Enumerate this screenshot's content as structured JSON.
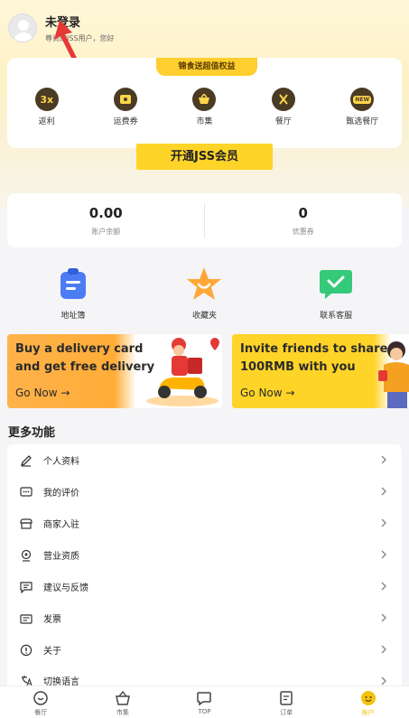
{
  "profile": {
    "name": "未登录",
    "subtitle": "尊贵的JSS用户，您好"
  },
  "benefits": {
    "tag": "锦食送超值权益",
    "items": [
      {
        "label": "返利",
        "icon": "rebate-icon",
        "glyph": "3x"
      },
      {
        "label": "运费券",
        "icon": "coupon-icon",
        "glyph": ""
      },
      {
        "label": "市集",
        "icon": "basket-icon",
        "glyph": ""
      },
      {
        "label": "餐厅",
        "icon": "utensils-icon",
        "glyph": ""
      },
      {
        "label": "甄选餐厅",
        "icon": "new-badge-icon",
        "glyph": "NEW"
      }
    ]
  },
  "vip_button": "开通JSS会员",
  "wallet": {
    "balance_value": "0.00",
    "balance_label": "账户余额",
    "coupon_value": "0",
    "coupon_label": "优惠券"
  },
  "shortcuts": [
    {
      "label": "地址簿",
      "icon": "address-book-icon"
    },
    {
      "label": "收藏夹",
      "icon": "star-icon"
    },
    {
      "label": "联系客服",
      "icon": "chat-check-icon"
    }
  ],
  "promos": [
    {
      "title_line1": "Buy a delivery card",
      "title_line2": "and get free delivery",
      "cta": "Go Now  →"
    },
    {
      "title_line1": "Invite friends to share",
      "title_line2": "100RMB with you",
      "cta": "Go Now  →"
    }
  ],
  "more_title": "更多功能",
  "menu": [
    {
      "label": "个人资料",
      "icon": "edit-icon"
    },
    {
      "label": "我的评价",
      "icon": "comment-icon"
    },
    {
      "label": "商家入驻",
      "icon": "store-icon"
    },
    {
      "label": "营业资质",
      "icon": "certificate-icon"
    },
    {
      "label": "建议与反馈",
      "icon": "feedback-icon"
    },
    {
      "label": "发票",
      "icon": "invoice-icon"
    },
    {
      "label": "关于",
      "icon": "info-icon"
    },
    {
      "label": "切换语言",
      "icon": "language-icon"
    }
  ],
  "tabbar": [
    {
      "label": "餐厅",
      "icon": "restaurant-tab-icon"
    },
    {
      "label": "市集",
      "icon": "market-tab-icon"
    },
    {
      "label": "TOP",
      "icon": "top-tab-icon"
    },
    {
      "label": "订单",
      "icon": "orders-tab-icon"
    },
    {
      "label": "账户",
      "icon": "account-tab-icon",
      "active": true
    }
  ],
  "colors": {
    "accent": "#ffd428",
    "arrow": "#e53935",
    "active_tab": "#f4c20d"
  }
}
